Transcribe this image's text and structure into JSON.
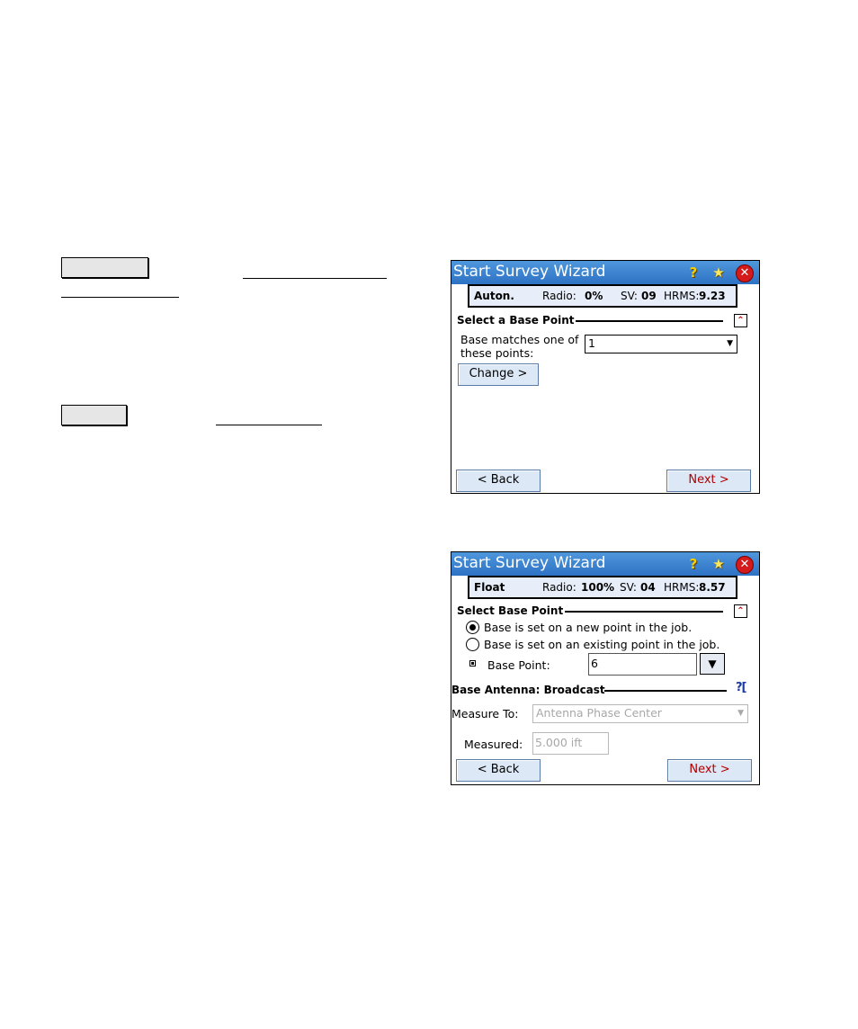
{
  "window1": {
    "title": "Start Survey Wizard",
    "icons": [
      "help-icon",
      "favorites-star-icon",
      "close-icon"
    ],
    "status": {
      "mode": "Auton.",
      "radio_label": "Radio:",
      "radio_value": "0%",
      "sv_label": "SV:",
      "sv_value": "09",
      "hrms_label": "HRMS:",
      "hrms_value": "9.23"
    },
    "section_title": "Select a Base Point",
    "match_label_line1": "Base matches one of",
    "match_label_line2": "these points:",
    "match_value": "1",
    "change_button": "Change >",
    "back_button": "< Back",
    "next_button": "Next >"
  },
  "window2": {
    "title": "Start Survey Wizard",
    "icons": [
      "help-icon",
      "favorites-star-icon",
      "close-icon"
    ],
    "status": {
      "mode": "Float",
      "radio_label": "Radio:",
      "radio_value": "100%",
      "sv_label": "SV:",
      "sv_value": "04",
      "hrms_label": "HRMS:",
      "hrms_value": "8.57"
    },
    "section_title": "Select Base Point",
    "option_new": "Base is set on a new point in the job.",
    "option_existing": "Base is set on an existing point in the job.",
    "base_point_label": "Base Point:",
    "base_point_value": "6",
    "antenna_section_title": "Base Antenna: Broadcast",
    "measure_to_label": "Measure To:",
    "measure_to_value": "Antenna Phase Center",
    "measured_label": "Measured:",
    "measured_value": "5.000 ift",
    "back_button": "< Back",
    "next_button": "Next >"
  },
  "colors": {
    "titlebar": "#2d72c4",
    "button_face": "#dce8f6",
    "next_text": "#b00000",
    "status_bg": "#e7eefa"
  }
}
